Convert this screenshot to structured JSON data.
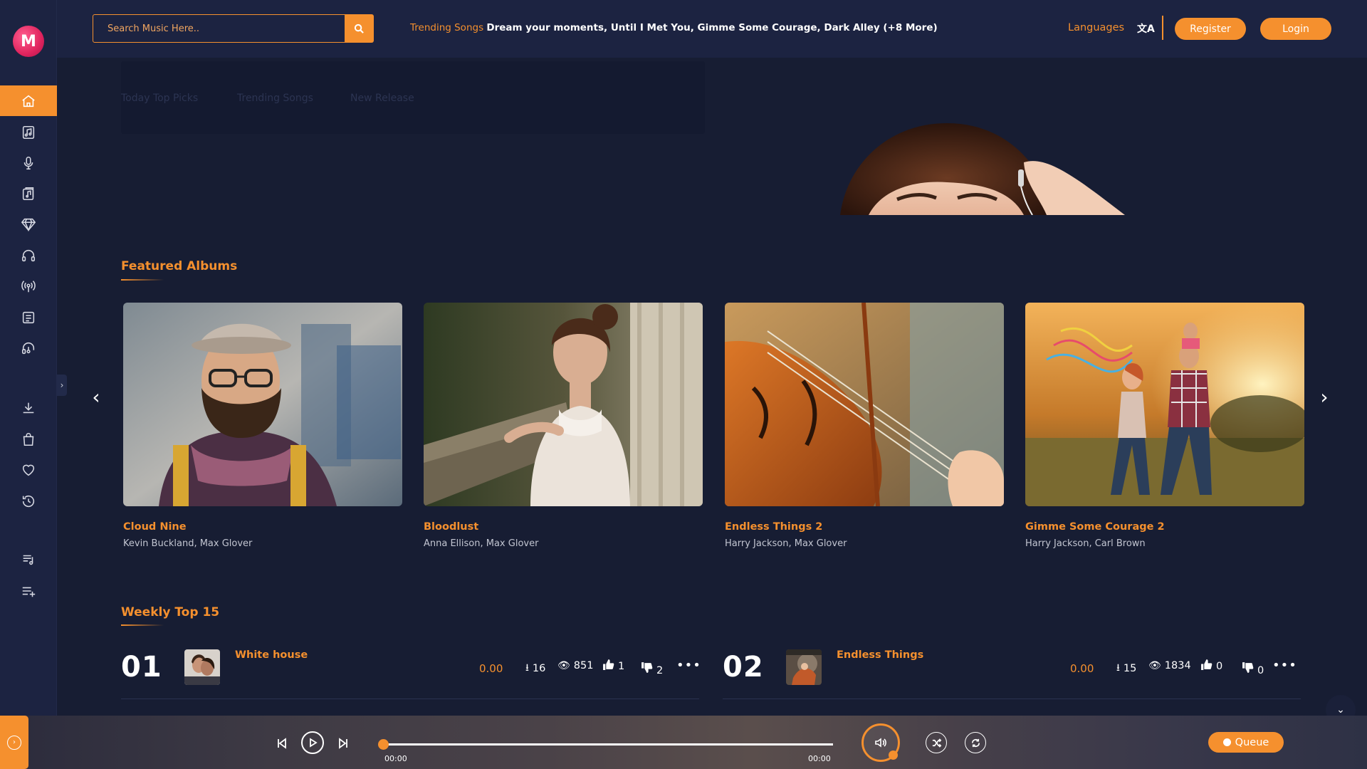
{
  "app": {
    "logo_letter": "M",
    "accent": "#f5902e",
    "background": "#171d33"
  },
  "sidebar": {
    "items": [
      {
        "icon": "home-icon",
        "active": true
      },
      {
        "icon": "music-library-icon"
      },
      {
        "icon": "microphone-icon"
      },
      {
        "icon": "music-note-icon"
      },
      {
        "icon": "diamond-icon"
      },
      {
        "icon": "headphones-icon"
      },
      {
        "icon": "radio-broadcast-icon"
      },
      {
        "icon": "news-icon"
      },
      {
        "icon": "podcast-icon"
      },
      {
        "icon": "download-icon"
      },
      {
        "icon": "shopping-bag-icon"
      },
      {
        "icon": "heart-icon"
      },
      {
        "icon": "history-icon"
      },
      {
        "icon": "playlist-icon"
      },
      {
        "icon": "add-playlist-icon"
      }
    ],
    "toggle": "›"
  },
  "header": {
    "search_placeholder": "Search Music Here..",
    "trending_label": "Trending Songs",
    "trending_songs": "Dream your moments, Until I Met You, Gimme Some Courage, Dark Alley (+8 More)",
    "languages": "Languages",
    "language_icon": "文A",
    "register": "Register",
    "login": "Login"
  },
  "banner": {
    "tabs": [
      "Today Top Picks",
      "Trending Songs",
      "New Release"
    ]
  },
  "featured": {
    "title": "Featured Albums",
    "prev": "‹",
    "next": "›",
    "albums": [
      {
        "title": "Cloud Nine",
        "artists": "Kevin Buckland, Max Glover"
      },
      {
        "title": "Bloodlust",
        "artists": "Anna Ellison, Max Glover"
      },
      {
        "title": "Endless Things 2",
        "artists": "Harry Jackson, Max Glover"
      },
      {
        "title": "Gimme Some Courage 2",
        "artists": "Harry Jackson, Carl Brown"
      }
    ]
  },
  "weekly": {
    "title": "Weekly Top 15",
    "tracks": [
      {
        "rank": "01",
        "title": "White house",
        "price": "0.00",
        "downloads": "16",
        "views": "851",
        "likes": "1",
        "dislikes": "2",
        "more": "•••"
      },
      {
        "rank": "02",
        "title": "Endless Things",
        "price": "0.00",
        "downloads": "15",
        "views": "1834",
        "likes": "0",
        "dislikes": "0",
        "more": "•••"
      }
    ]
  },
  "player": {
    "current_time": "00:00",
    "duration": "00:00",
    "progress": 0,
    "queue": "Queue"
  },
  "scroll_down": "⌄"
}
